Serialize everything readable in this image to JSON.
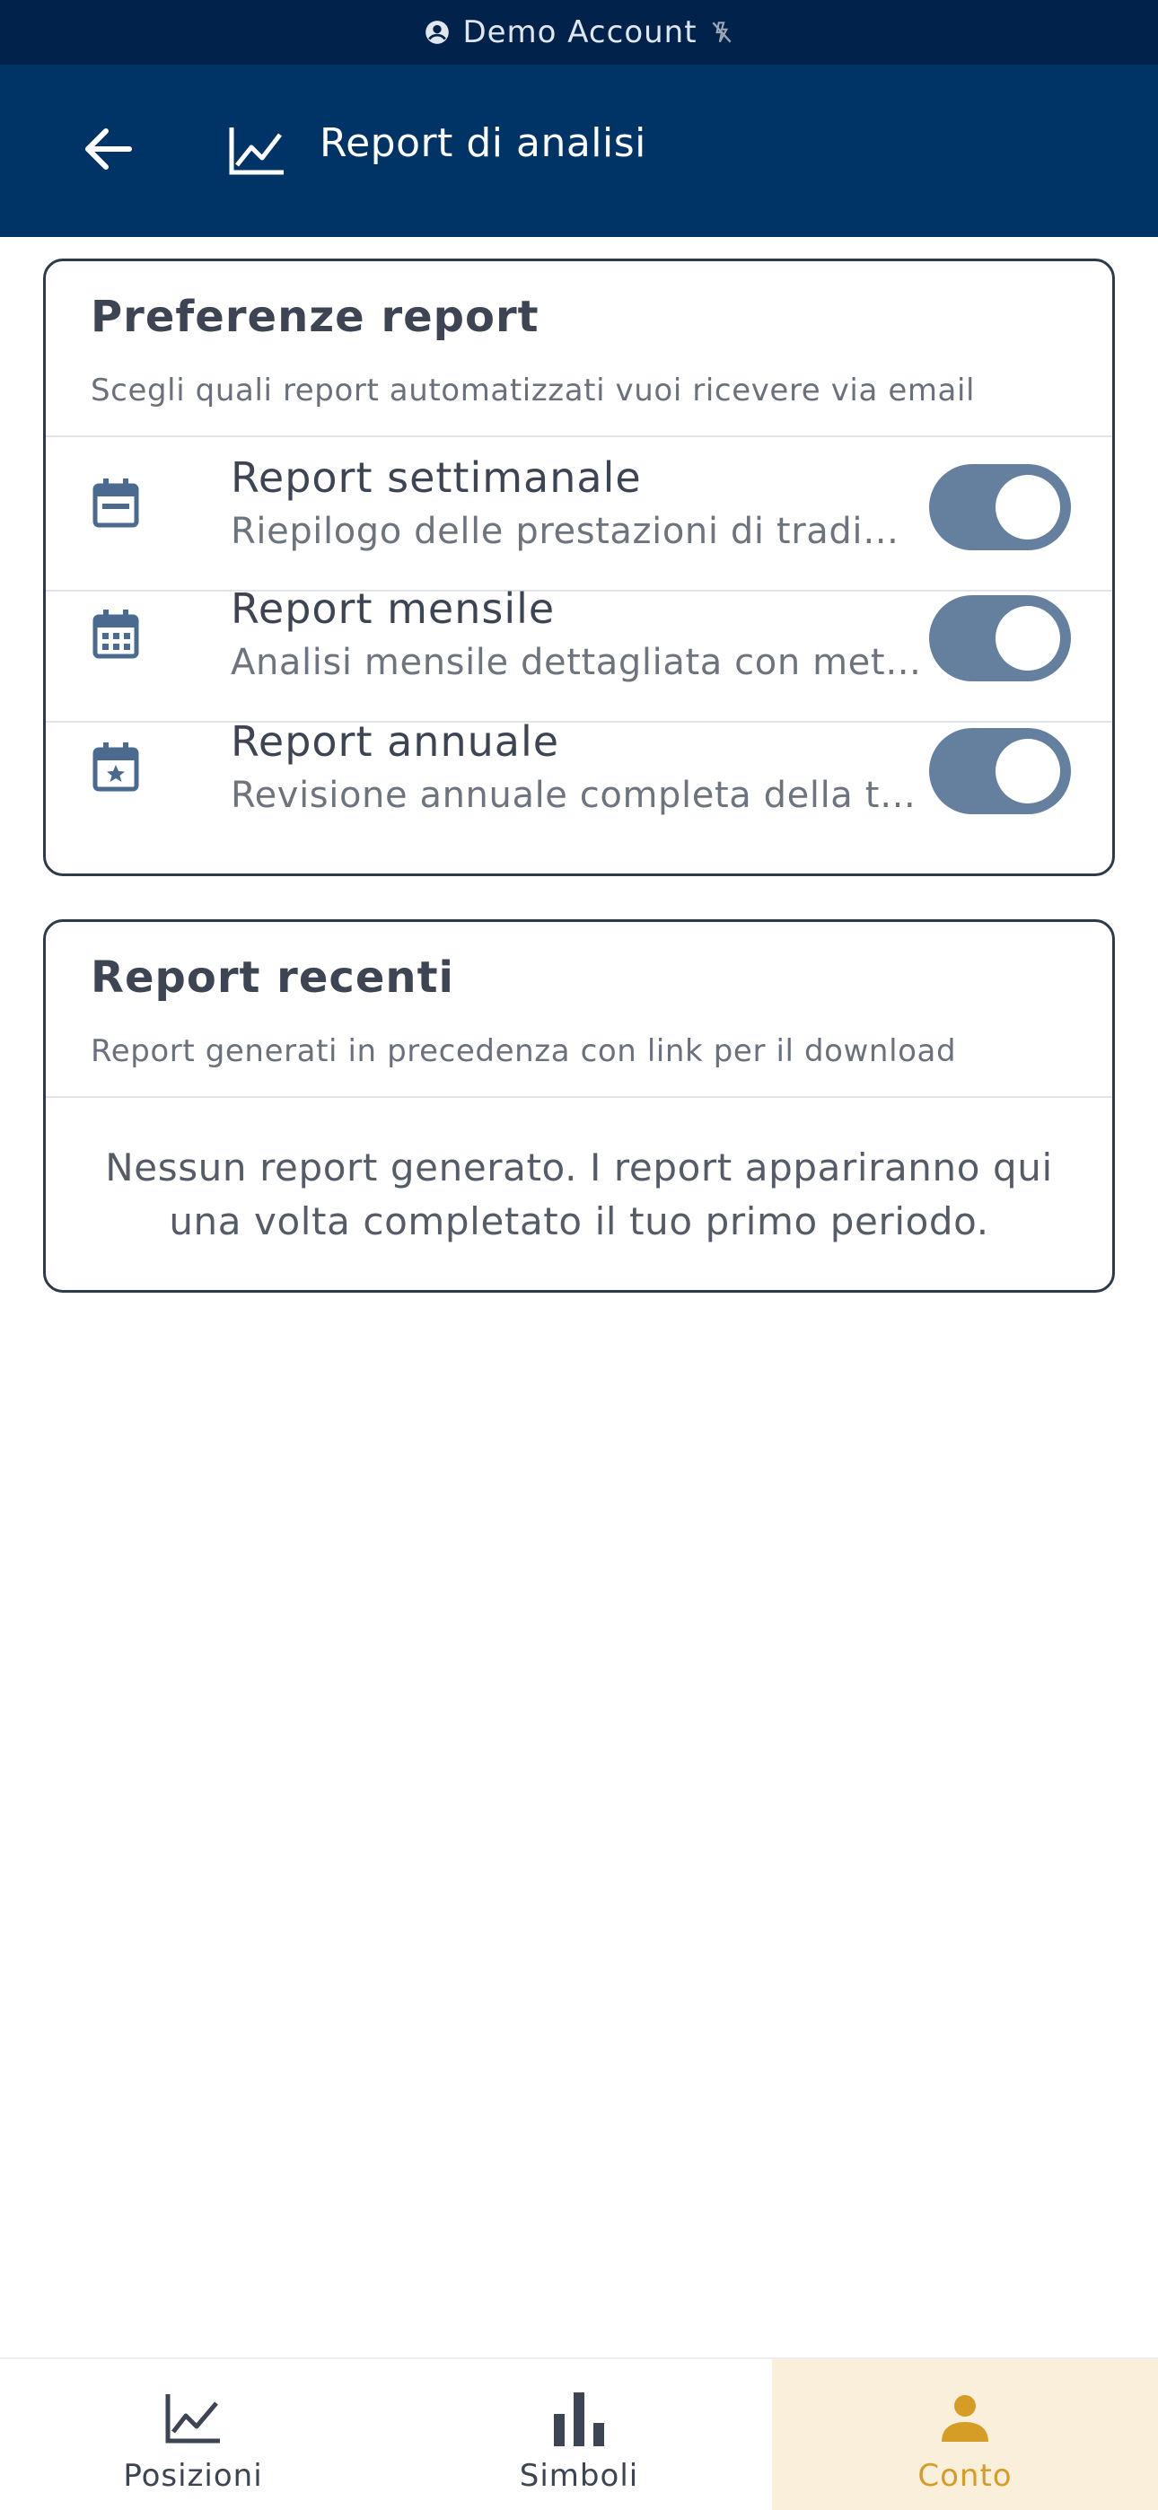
{
  "status_bar": {
    "account_label": "Demo Account",
    "account_icon": "account-circle-icon",
    "indicator_icon": "signal-off-icon"
  },
  "app_bar": {
    "back_icon": "arrow-back-icon",
    "title_icon": "line-chart-icon",
    "title": "Report di analisi"
  },
  "preferences_card": {
    "title": "Preferenze report",
    "subtitle": "Scegli quali report automatizzati vuoi ricevere via email",
    "rows": [
      {
        "icon": "calendar-week-icon",
        "title": "Report settimanale",
        "description": "Riepilogo delle prestazioni di trading settimanali",
        "enabled": true
      },
      {
        "icon": "calendar-month-icon",
        "title": "Report mensile",
        "description": "Analisi mensile dettagliata con metriche avanzate",
        "enabled": true
      },
      {
        "icon": "calendar-star-icon",
        "title": "Report annuale",
        "description": "Revisione annuale completa della tua attività",
        "enabled": true
      }
    ]
  },
  "recent_card": {
    "title": "Report recenti",
    "subtitle": "Report generati in precedenza con link per il download",
    "empty_message": "Nessun report generato. I report appariranno qui una volta completato il tuo primo periodo."
  },
  "bottom_nav": {
    "items": [
      {
        "icon": "line-chart-icon",
        "label": "Posizioni",
        "active": false
      },
      {
        "icon": "bar-chart-icon",
        "label": "Simboli",
        "active": false
      },
      {
        "icon": "person-icon",
        "label": "Conto",
        "active": true
      }
    ]
  },
  "colors": {
    "status_bar": "#01224a",
    "app_bar": "#003366",
    "toggle_on": "#657f9e",
    "icon_blue": "#4b6a8f",
    "active_nav_bg": "#faefdb",
    "active_nav_fg": "#d69d26"
  }
}
